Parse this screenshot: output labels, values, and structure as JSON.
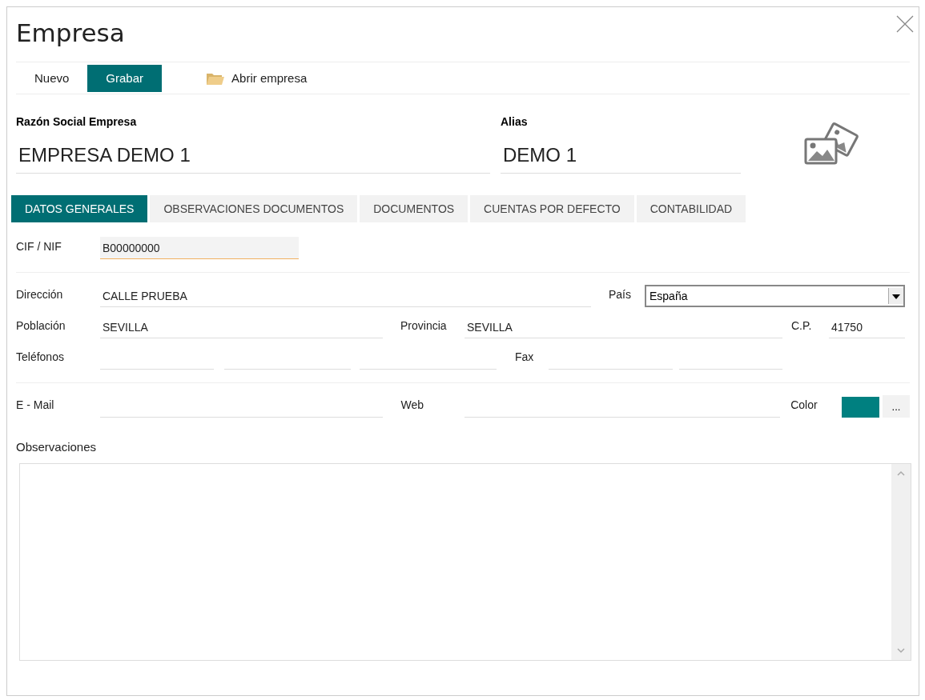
{
  "window": {
    "title": "Empresa"
  },
  "toolbar": {
    "buttons": [
      {
        "label": "Nuevo",
        "selected": false
      },
      {
        "label": "Grabar",
        "selected": true
      }
    ],
    "open_button": {
      "label": "Abrir empresa"
    }
  },
  "header": {
    "company_name": {
      "label": "Razón Social Empresa",
      "value": "EMPRESA DEMO 1"
    },
    "alias": {
      "label": "Alias",
      "value": "DEMO 1"
    }
  },
  "tabs": [
    {
      "label": "DATOS GENERALES",
      "selected": true
    },
    {
      "label": "OBSERVACIONES DOCUMENTOS",
      "selected": false
    },
    {
      "label": "DOCUMENTOS",
      "selected": false
    },
    {
      "label": "CUENTAS POR DEFECTO",
      "selected": false
    },
    {
      "label": "CONTABILIDAD",
      "selected": false
    }
  ],
  "general": {
    "cif": {
      "label": "CIF / NIF",
      "value": "B00000000",
      "focused": true
    },
    "address": {
      "label": "Dirección",
      "value": "CALLE PRUEBA"
    },
    "country": {
      "label": "País",
      "value": "España"
    },
    "city": {
      "label": "Población",
      "value": "SEVILLA"
    },
    "province": {
      "label": "Provincia",
      "value": "SEVILLA"
    },
    "postal_code": {
      "label": "C.P.",
      "value": "41750"
    },
    "phones": {
      "label": "Teléfonos"
    },
    "fax": {
      "label": "Fax"
    },
    "email": {
      "label": "E - Mail"
    },
    "web": {
      "label": "Web"
    },
    "color": {
      "label": "Color",
      "color": "#008080",
      "button": "..."
    },
    "notes": {
      "label": "Observaciones"
    }
  }
}
